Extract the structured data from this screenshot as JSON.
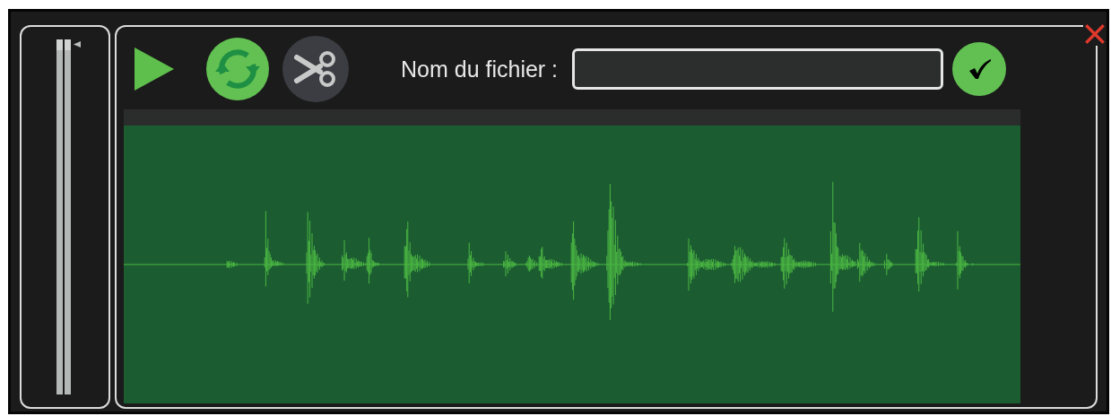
{
  "volume_slider": {
    "level": 1
  },
  "toolbar": {
    "buttons": [
      {
        "kind": "play",
        "disabled": false
      },
      {
        "kind": "loop",
        "disabled": false
      },
      {
        "kind": "cut",
        "disabled": true
      }
    ],
    "filename_label": "Nom du fichier :"
  }
}
